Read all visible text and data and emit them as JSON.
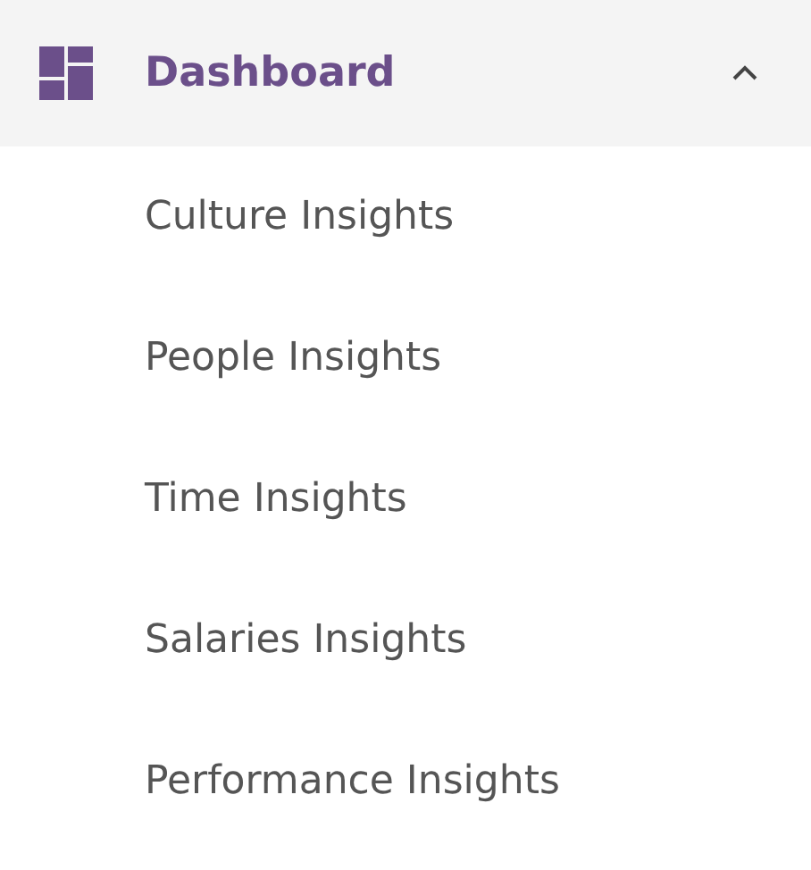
{
  "menu": {
    "label": "Dashboard",
    "expanded": true,
    "items": [
      {
        "label": "Culture Insights"
      },
      {
        "label": "People Insights"
      },
      {
        "label": "Time Insights"
      },
      {
        "label": "Salaries Insights"
      },
      {
        "label": "Performance Insights"
      }
    ]
  }
}
